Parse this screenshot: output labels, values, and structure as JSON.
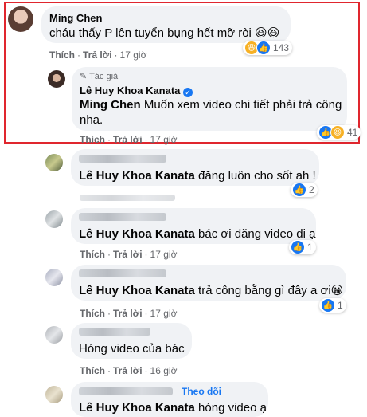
{
  "colors": {
    "like": "#1877f2",
    "haha": "#f7b125",
    "highlight": "#e0262e"
  },
  "actions": {
    "like": "Thích",
    "reply": "Trả lời",
    "sep": "·"
  },
  "c1": {
    "name": "Ming Chen",
    "text": "cháu thấy P lên tuyển bụng hết mỡ ròi 😆😆",
    "time": "17 giờ",
    "reactions": "143"
  },
  "r1": {
    "author_badge": "Tác giả",
    "name": "Lê Huy Khoa Kanata",
    "mention": "Ming Chen",
    "text1": "Muốn xem video chi tiết phải trả công",
    "text2": "nha.",
    "time": "17 giờ",
    "reactions": "41"
  },
  "r2": {
    "mention": "Lê Huy Khoa Kanata",
    "text": "đăng luôn cho sốt ah !",
    "reactions": "2"
  },
  "r3": {
    "mention": "Lê Huy Khoa Kanata",
    "text": "bác ơi đăng video đi ạ",
    "time": "17 giờ",
    "reactions": "1"
  },
  "r4": {
    "mention": "Lê Huy Khoa Kanata",
    "text": "trả công bằng gì đây a ơi😀",
    "time": "17 giờ",
    "reactions": "1"
  },
  "r5": {
    "text": "Hóng video của bác",
    "time": "16 giờ"
  },
  "r6": {
    "follow": "Theo dõi",
    "mention": "Lê Huy Khoa Kanata",
    "text": "hóng video ạ"
  }
}
